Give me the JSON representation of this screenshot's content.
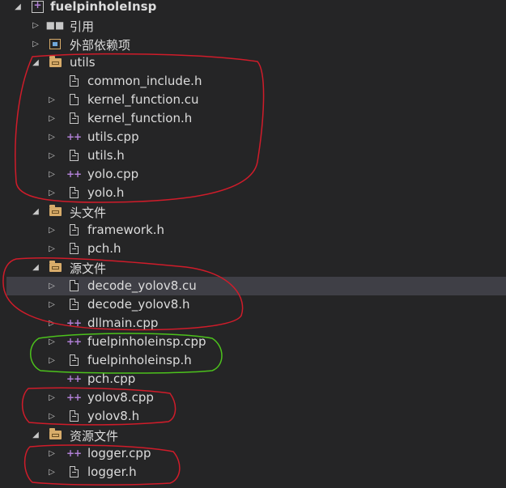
{
  "tree": {
    "root": {
      "label": "fuelpinholeInsp"
    },
    "items": [
      {
        "label": "引用",
        "icon": "references-icon",
        "expander": "collapsed",
        "level": 1
      },
      {
        "label": "外部依赖项",
        "icon": "external-dependencies-icon",
        "expander": "collapsed",
        "level": 1
      },
      {
        "label": "utils",
        "icon": "folder-icon",
        "expander": "expanded",
        "level": 1
      },
      {
        "label": "common_include.h",
        "icon": "header-file-icon",
        "expander": "none",
        "level": 2
      },
      {
        "label": "kernel_function.cu",
        "icon": "file-icon",
        "expander": "collapsed",
        "level": 2
      },
      {
        "label": "kernel_function.h",
        "icon": "header-file-icon",
        "expander": "collapsed",
        "level": 2
      },
      {
        "label": "utils.cpp",
        "icon": "cpp-file-icon",
        "expander": "collapsed",
        "level": 2
      },
      {
        "label": "utils.h",
        "icon": "header-file-icon",
        "expander": "collapsed",
        "level": 2
      },
      {
        "label": "yolo.cpp",
        "icon": "cpp-file-icon",
        "expander": "collapsed",
        "level": 2
      },
      {
        "label": "yolo.h",
        "icon": "header-file-icon",
        "expander": "collapsed",
        "level": 2
      },
      {
        "label": "头文件",
        "icon": "folder-icon",
        "expander": "expanded",
        "level": 1
      },
      {
        "label": "framework.h",
        "icon": "header-file-icon",
        "expander": "collapsed",
        "level": 2
      },
      {
        "label": "pch.h",
        "icon": "header-file-icon",
        "expander": "collapsed",
        "level": 2
      },
      {
        "label": "源文件",
        "icon": "folder-icon",
        "expander": "expanded",
        "level": 1
      },
      {
        "label": "decode_yolov8.cu",
        "icon": "file-icon",
        "expander": "collapsed",
        "level": 2,
        "selected": true
      },
      {
        "label": "decode_yolov8.h",
        "icon": "header-file-icon",
        "expander": "collapsed",
        "level": 2
      },
      {
        "label": "dllmain.cpp",
        "icon": "cpp-file-icon",
        "expander": "collapsed",
        "level": 2
      },
      {
        "label": "fuelpinholeinsp.cpp",
        "icon": "cpp-file-icon",
        "expander": "collapsed",
        "level": 2
      },
      {
        "label": "fuelpinholeinsp.h",
        "icon": "header-file-icon",
        "expander": "collapsed",
        "level": 2
      },
      {
        "label": "pch.cpp",
        "icon": "cpp-file-icon",
        "expander": "none",
        "level": 2
      },
      {
        "label": "yolov8.cpp",
        "icon": "cpp-file-icon",
        "expander": "collapsed",
        "level": 2
      },
      {
        "label": "yolov8.h",
        "icon": "header-file-icon",
        "expander": "collapsed",
        "level": 2
      },
      {
        "label": "资源文件",
        "icon": "folder-icon",
        "expander": "expanded",
        "level": 1
      },
      {
        "label": "logger.cpp",
        "icon": "cpp-file-icon",
        "expander": "collapsed",
        "level": 2
      },
      {
        "label": "logger.h",
        "icon": "header-file-icon",
        "expander": "collapsed",
        "level": 2
      }
    ]
  },
  "annotations": {
    "colors": {
      "red": "#d01c2a",
      "green": "#4cc21c"
    }
  }
}
